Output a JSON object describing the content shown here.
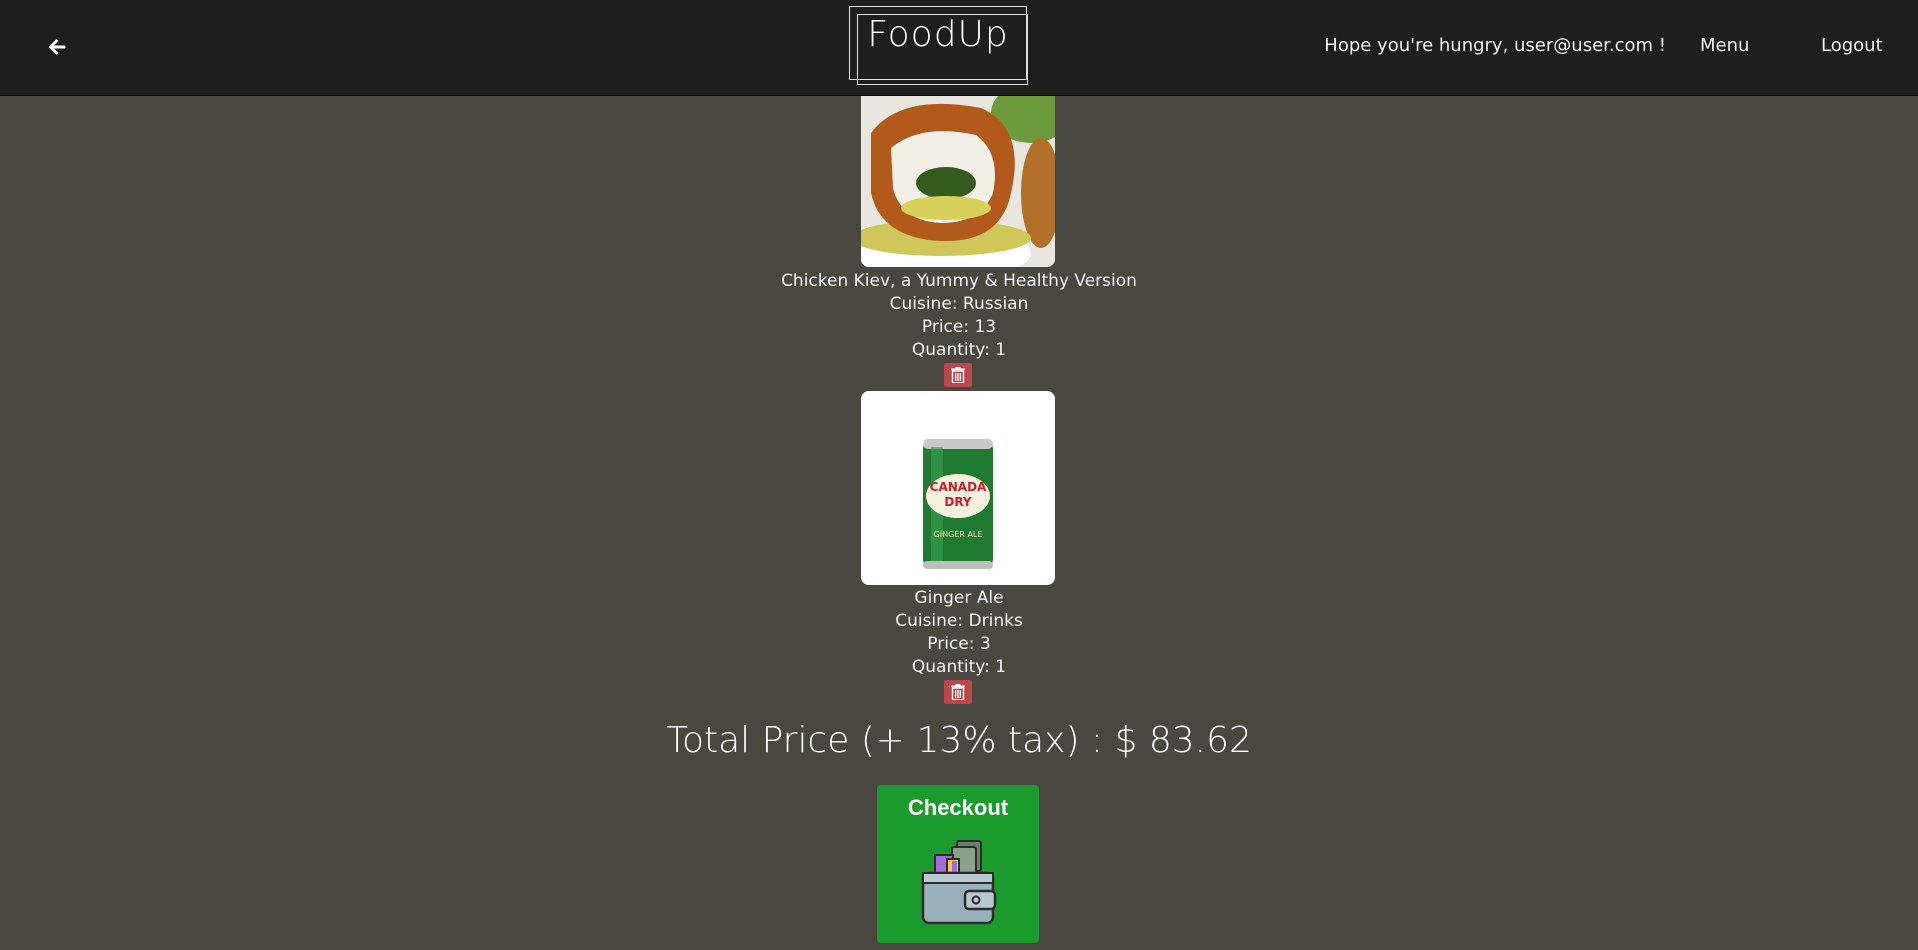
{
  "header": {
    "logo": "FoodUp",
    "greeting": "Hope you're hungry, user@user.com !",
    "nav": {
      "menu": "Menu",
      "logout": "Logout"
    },
    "back_icon": "arrow-left-icon"
  },
  "cart": {
    "items": [
      {
        "name": "Chicken Kiev, a Yummy & Healthy Version",
        "cuisine": "Cuisine: Russian",
        "price": "Price: 13",
        "quantity": "Quantity: 1",
        "image": "chicken-kiev-photo"
      },
      {
        "name": "Ginger Ale",
        "cuisine": "Cuisine: Drinks",
        "price": "Price: 3",
        "quantity": "Quantity: 1",
        "image": "ginger-ale-can-photo"
      }
    ],
    "total": "Total Price (+ 13% tax) : $ 83.62",
    "checkout_label": "Checkout",
    "delete_icon": "trash-icon"
  },
  "colors": {
    "topbar": "#1e1e1e",
    "background": "#4a4640",
    "delete": "#b9474b",
    "checkout": "#1b9a2d"
  }
}
